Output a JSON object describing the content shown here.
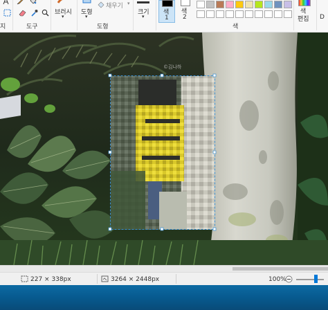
{
  "ribbon": {
    "groups": {
      "tools": "도구",
      "shapes": "도형",
      "colors": "색"
    },
    "clipped_group_label": "지",
    "brush_label": "브러시",
    "shapes_label": "도형",
    "fill_label": "채우기",
    "size_label": "크기",
    "color1_label": "색\n1",
    "color1_line1": "색",
    "color1_line2": "1",
    "color2_line1": "색",
    "color2_line2": "2",
    "edit_colors_line1": "색",
    "edit_colors_line2": "편집",
    "edit_colors_trailing": "D",
    "palette_row1": [
      "#ffffff",
      "#c3c3c3",
      "#b97a57",
      "#ffaec9",
      "#ffc90e",
      "#efe4b0",
      "#b5e61d",
      "#99d9ea",
      "#7092be",
      "#c8bfe7"
    ],
    "palette_row2": [
      "#ffffff",
      "#ffffff",
      "#ffffff",
      "#ffffff",
      "#ffffff",
      "#ffffff",
      "#ffffff",
      "#ffffff",
      "#ffffff",
      "#ffffff"
    ],
    "color1": "#000000",
    "color2": "#ffffff"
  },
  "canvas": {
    "watermark": "©김나하"
  },
  "status": {
    "selection_size": "227 × 338px",
    "image_size": "3264 × 2448px",
    "zoom": "100%"
  },
  "colors": {
    "accent": "#0078d7",
    "selection_border": "#3c8fd1",
    "taskbar": "#0b5f96"
  }
}
